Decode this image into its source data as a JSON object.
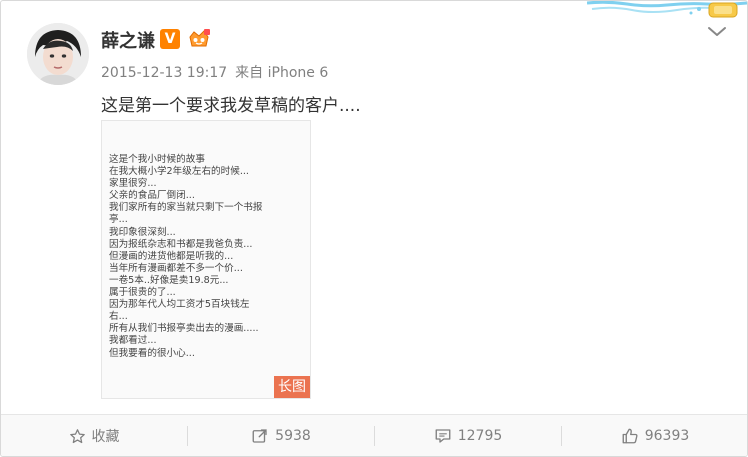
{
  "post": {
    "author": "薛之谦",
    "verified_badge": "V",
    "timestamp": "2015-12-13 19:17",
    "source_prefix": "来自",
    "source": "iPhone 6",
    "text": "这是第一个要求我发草稿的客户....",
    "image": {
      "badge": "长图",
      "lines": [
        "这是个我小时候的故事",
        "在我大概小学2年级左右的时候...",
        "家里很穷...",
        "父亲的食品厂倒闭...",
        "我们家所有的家当就只剩下一个书报",
        "亭...",
        "我印象很深刻...",
        "因为报纸杂志和书都是我爸负责...",
        "但漫画的进货他都是听我的...",
        "当年所有漫画都差不多一个价...",
        "一卷5本..好像是卖19.8元...",
        "属于很贵的了...",
        "因为那年代人均工资才5百块钱左",
        "右...",
        "所有从我们书报亭卖出去的漫画.....",
        "我都看过...",
        "但我要看的很小心..."
      ]
    }
  },
  "actions": {
    "favorite": "收藏",
    "repost": "5938",
    "comment": "12795",
    "like": "96393"
  },
  "colors": {
    "accent": "#ff8200",
    "long_image_badge": "#eb7350",
    "meta_text": "#808080"
  }
}
